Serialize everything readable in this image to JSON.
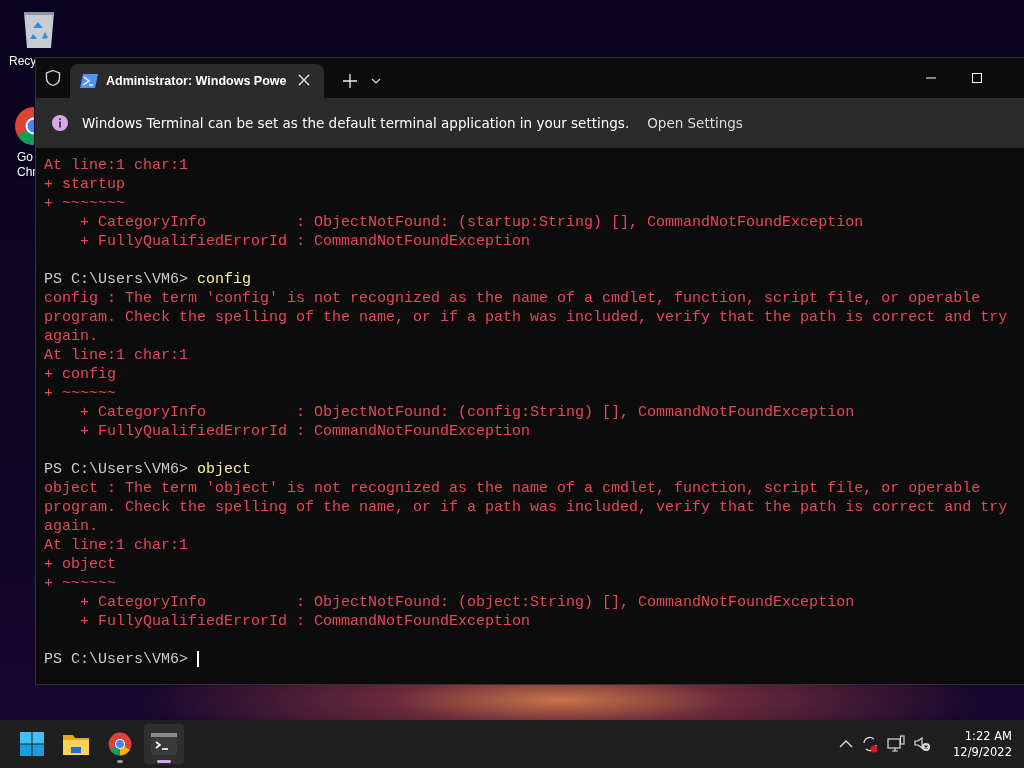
{
  "desktop_icons": [
    {
      "label": "Recy",
      "kind": "bin"
    },
    {
      "label": "Go\nChr",
      "kind": "chrome"
    }
  ],
  "window": {
    "tab": {
      "title": "Administrator: Windows Powe",
      "selected": true
    },
    "infobar": {
      "message": "Windows Terminal can be set as the default terminal application in your settings.",
      "action": "Open Settings"
    },
    "terminal": {
      "lines": [
        {
          "kind": "error",
          "text": "At line:1 char:1"
        },
        {
          "kind": "error",
          "text": "+ startup"
        },
        {
          "kind": "error",
          "text": "+ ~~~~~~~"
        },
        {
          "kind": "error",
          "text": "    + CategoryInfo          : ObjectNotFound: (startup:String) [], CommandNotFoundException"
        },
        {
          "kind": "error",
          "text": "    + FullyQualifiedErrorId : CommandNotFoundException"
        },
        {
          "kind": "blank"
        },
        {
          "kind": "prompt",
          "prompt": "PS C:\\Users\\VM6>",
          "command": "config",
          "cursor": false
        },
        {
          "kind": "error",
          "text": "config : The term 'config' is not recognized as the name of a cmdlet, function, script file, or operable"
        },
        {
          "kind": "error",
          "text": "program. Check the spelling of the name, or if a path was included, verify that the path is correct and try"
        },
        {
          "kind": "error",
          "text": "again."
        },
        {
          "kind": "error",
          "text": "At line:1 char:1"
        },
        {
          "kind": "error",
          "text": "+ config"
        },
        {
          "kind": "error",
          "text": "+ ~~~~~~"
        },
        {
          "kind": "error",
          "text": "    + CategoryInfo          : ObjectNotFound: (config:String) [], CommandNotFoundException"
        },
        {
          "kind": "error",
          "text": "    + FullyQualifiedErrorId : CommandNotFoundException"
        },
        {
          "kind": "blank"
        },
        {
          "kind": "prompt",
          "prompt": "PS C:\\Users\\VM6>",
          "command": "object",
          "cursor": false
        },
        {
          "kind": "error",
          "text": "object : The term 'object' is not recognized as the name of a cmdlet, function, script file, or operable"
        },
        {
          "kind": "error",
          "text": "program. Check the spelling of the name, or if a path was included, verify that the path is correct and try"
        },
        {
          "kind": "error",
          "text": "again."
        },
        {
          "kind": "error",
          "text": "At line:1 char:1"
        },
        {
          "kind": "error",
          "text": "+ object"
        },
        {
          "kind": "error",
          "text": "+ ~~~~~~"
        },
        {
          "kind": "error",
          "text": "    + CategoryInfo          : ObjectNotFound: (object:String) [], CommandNotFoundException"
        },
        {
          "kind": "error",
          "text": "    + FullyQualifiedErrorId : CommandNotFoundException"
        },
        {
          "kind": "blank"
        },
        {
          "kind": "prompt",
          "prompt": "PS C:\\Users\\VM6>",
          "cursor": true
        }
      ]
    }
  },
  "taskbar": {
    "apps": [
      {
        "kind": "start",
        "running": false,
        "active": false
      },
      {
        "kind": "folder",
        "running": false,
        "active": false
      },
      {
        "kind": "chrome",
        "running": true,
        "active": false
      },
      {
        "kind": "terminal",
        "running": true,
        "active": true
      }
    ],
    "clock": {
      "time": "1:22 AM",
      "date": "12/9/2022"
    }
  }
}
